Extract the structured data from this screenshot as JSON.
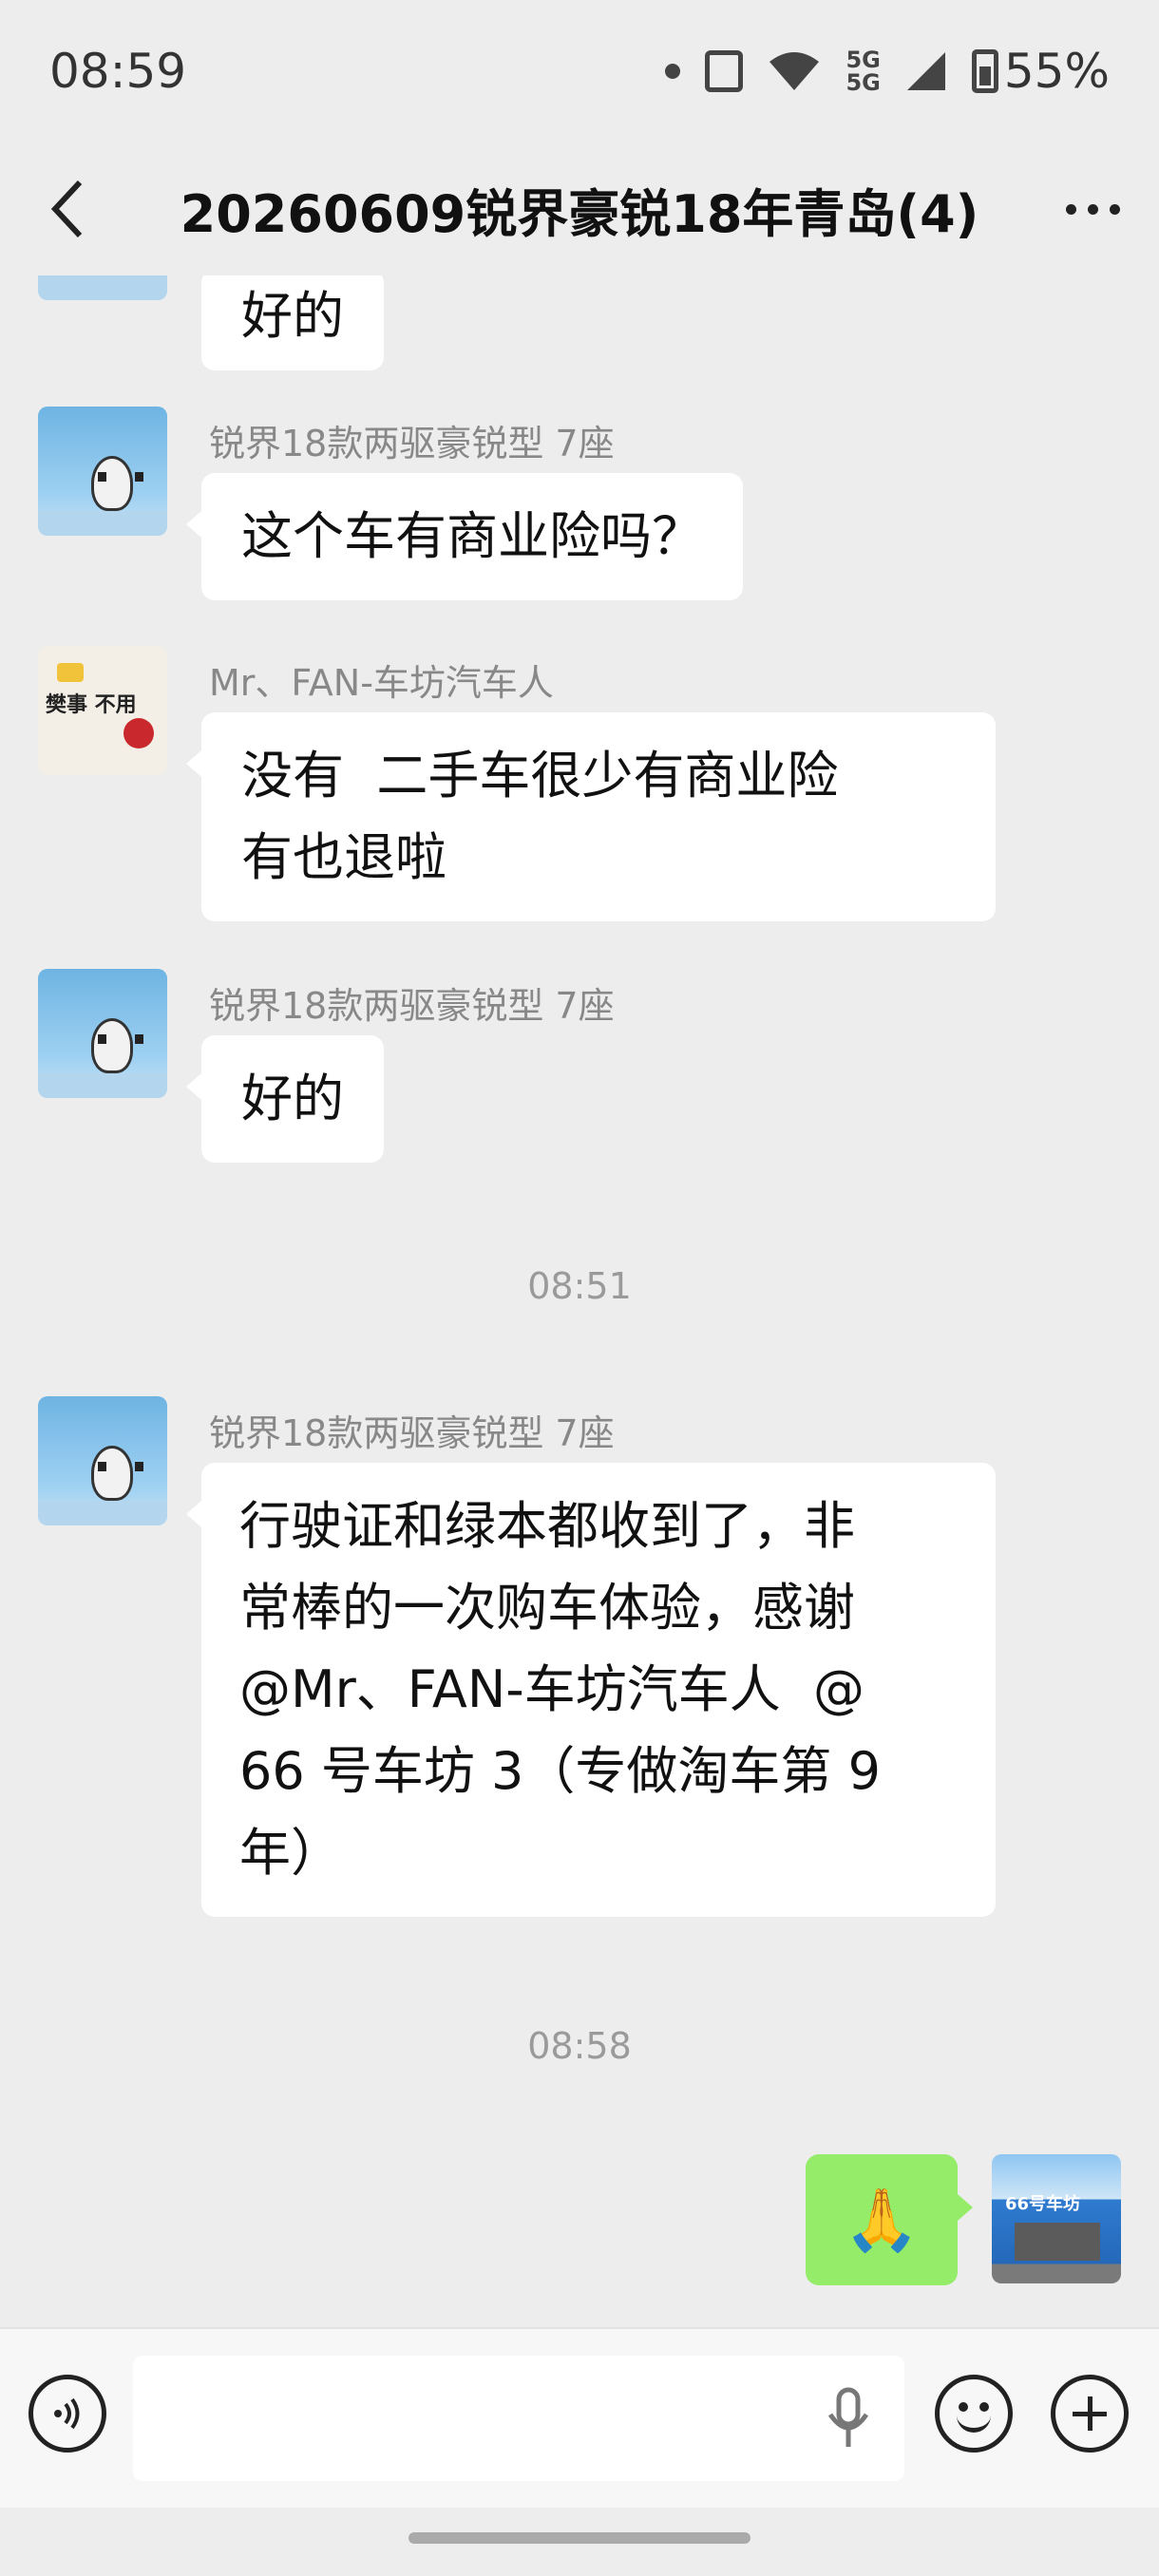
{
  "status_bar": {
    "time": "08:59",
    "network_top": "5G",
    "network_bottom": "5G",
    "battery": "55%"
  },
  "header": {
    "title": "20260609锐界豪锐18年青岛(4)"
  },
  "messages": [
    {
      "sender": "",
      "text": "好的"
    },
    {
      "sender": "锐界18款两驱豪锐型 7座",
      "text": "这个车有商业险吗？"
    },
    {
      "sender": "Mr、FAN-车坊汽车人",
      "avatar_text": "樊事 不用",
      "lines": [
        "没有  二手车很少有商业险",
        "有也退啦"
      ]
    },
    {
      "sender": "锐界18款两驱豪锐型 7座",
      "text": "好的"
    },
    {
      "sender": "锐界18款两驱豪锐型 7座",
      "lines": [
        "行驶证和绿本都收到了，非",
        "常棒的一次购车体验，感谢",
        "@Mr、FAN-车坊汽车人  @",
        "66 号车坊 3（专做淘车第 9",
        "年）"
      ]
    }
  ],
  "time_dividers": [
    "08:51",
    "08:58"
  ],
  "my_message": {
    "emoji": "🙏",
    "avatar_sign": "66号车坊"
  },
  "input_bar": {
    "placeholder": ""
  },
  "icons": {
    "back": "chevron-left-icon",
    "more": "more-dots-icon",
    "voice": "voice-icon",
    "mic": "mic-icon",
    "emoji": "emoji-icon",
    "plus": "plus-icon"
  }
}
